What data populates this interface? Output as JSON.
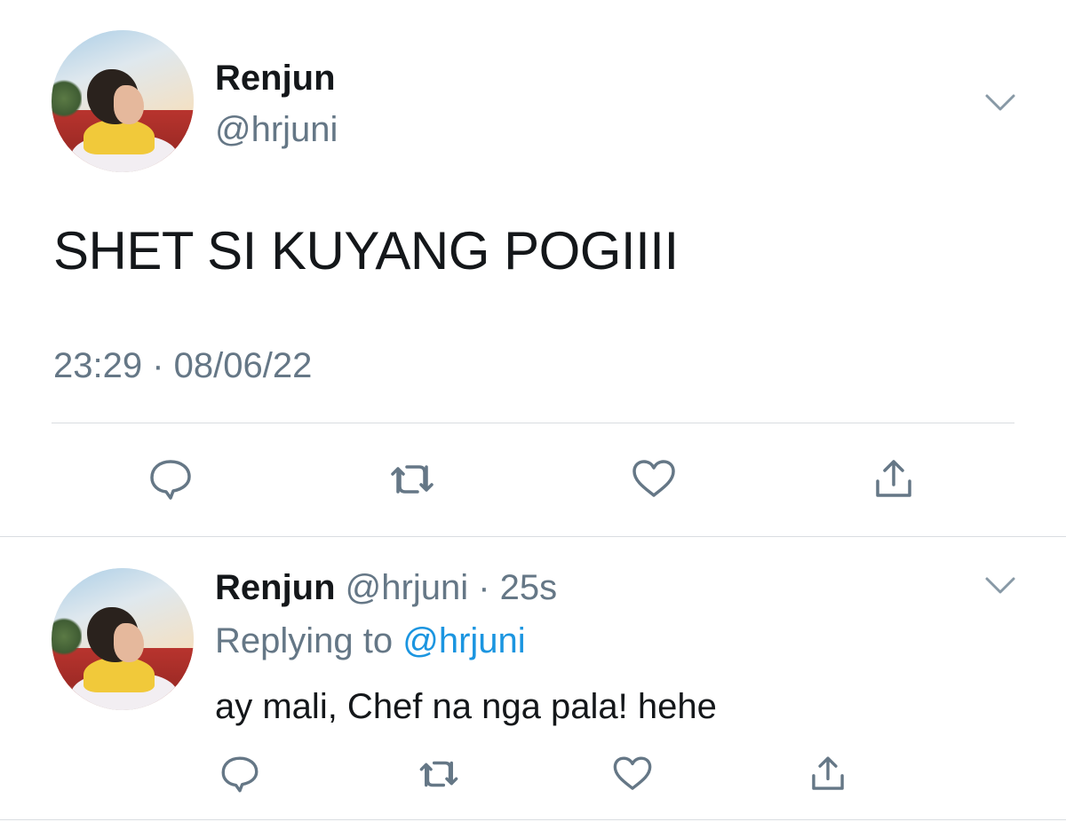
{
  "main_tweet": {
    "author_name": "Renjun",
    "author_handle": "@hrjuni",
    "text": "SHET SI KUYANG POGIIII",
    "timestamp": "23:29 · 08/06/22",
    "menu_icon": "chevron-down-icon",
    "actions": [
      {
        "name": "reply",
        "icon": "comment-icon"
      },
      {
        "name": "retweet",
        "icon": "retweet-icon"
      },
      {
        "name": "like",
        "icon": "heart-icon"
      },
      {
        "name": "share",
        "icon": "share-icon"
      }
    ]
  },
  "reply_tweet": {
    "author_name": "Renjun",
    "author_handle": "@hrjuni",
    "separator": " · ",
    "time_ago": "25s",
    "replying_to_label": "Replying to",
    "replying_to_handle": "@hrjuni",
    "text": "ay mali, Chef na nga pala! hehe",
    "menu_icon": "chevron-down-icon"
  },
  "colors": {
    "text_primary": "#14171a",
    "text_secondary": "#657786",
    "link": "#1b95e0",
    "divider": "#d9dde1",
    "icon": "#657786"
  }
}
